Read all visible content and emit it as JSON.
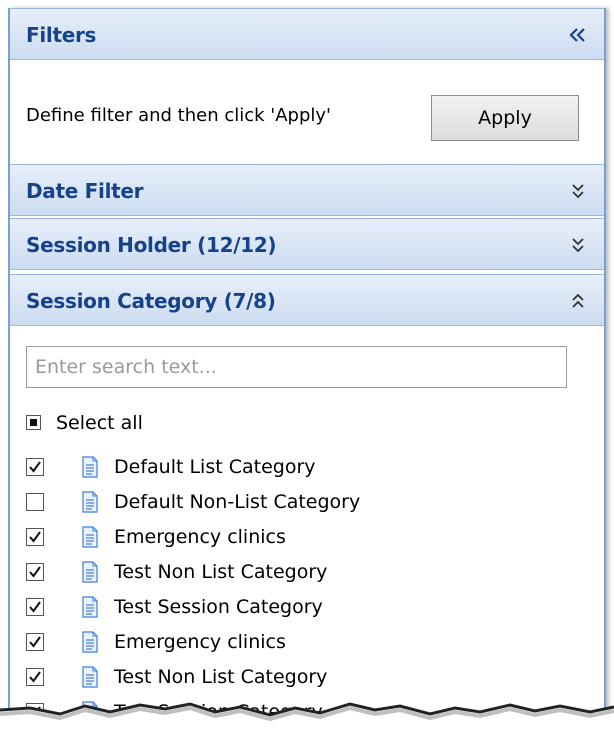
{
  "filters_header": {
    "title": "Filters",
    "collapse_icon": "chevrons-left-icon"
  },
  "apply_row": {
    "instruction": "Define filter and then click 'Apply'",
    "apply_label": "Apply"
  },
  "sections": [
    {
      "title": "Date Filter",
      "icon": "chevrons-down-icon"
    },
    {
      "title": "Session Holder (12/12)",
      "icon": "chevrons-down-icon"
    },
    {
      "title": "Session Category (7/8)",
      "icon": "chevrons-up-icon"
    }
  ],
  "category": {
    "search_placeholder": "Enter search text...",
    "select_all_label": "Select all",
    "items": [
      {
        "label": "Default List Category",
        "checked": true
      },
      {
        "label": "Default Non-List Category",
        "checked": false
      },
      {
        "label": "Emergency clinics",
        "checked": true
      },
      {
        "label": "Test Non List Category",
        "checked": true
      },
      {
        "label": "Test Session Category",
        "checked": true
      },
      {
        "label": "Emergency clinics",
        "checked": true
      },
      {
        "label": "Test Non List Category",
        "checked": true
      },
      {
        "label": "Test Session Category",
        "checked": true
      }
    ]
  },
  "colors": {
    "header_text": "#15428b",
    "header_bg_top": "#e7effa",
    "header_bg_bottom": "#ccdcf1",
    "border": "#7aa0cf",
    "doc_icon": "#3f7fd9"
  }
}
